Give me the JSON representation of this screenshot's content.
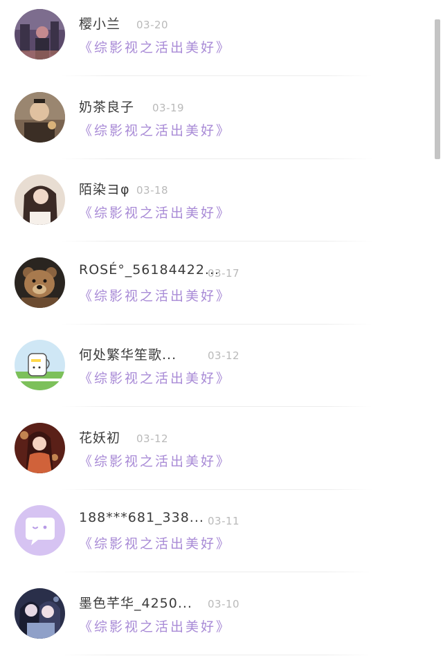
{
  "conversations": [
    {
      "name": "樱小兰",
      "date": "03-20",
      "book": "《综影视之活出美好》",
      "avatar_icon": "avatar-photo-icon",
      "avatar_colors": [
        "#5b4a6b",
        "#c48a8f",
        "#2f2a3a"
      ]
    },
    {
      "name": "奶茶良子",
      "date": "03-19",
      "book": "《综影视之活出美好》",
      "avatar_icon": "avatar-photo-icon",
      "avatar_colors": [
        "#7a6450",
        "#e0c1a0",
        "#3b2e25"
      ]
    },
    {
      "name": "陌染ヨφ",
      "date": "03-18",
      "book": "《综影视之活出美好》",
      "avatar_icon": "avatar-photo-icon",
      "avatar_colors": [
        "#d9cbbf",
        "#3b2a25",
        "#f0e6dc"
      ]
    },
    {
      "name": "ROSÉ°_56184422...",
      "date": "03-17",
      "book": "《综影视之活出美好》",
      "avatar_icon": "teddy-bear-icon",
      "avatar_colors": [
        "#2a2520",
        "#a87a4e",
        "#6b4b30"
      ]
    },
    {
      "name": "何处繁华笙歌...",
      "date": "03-12",
      "book": "《综影视之活出美好》",
      "avatar_icon": "cartoon-cup-icon",
      "avatar_colors": [
        "#cfe7f5",
        "#7cc05a",
        "#ffffff"
      ]
    },
    {
      "name": "花妖初",
      "date": "03-12",
      "book": "《综影视之活出美好》",
      "avatar_icon": "anime-girl-icon",
      "avatar_colors": [
        "#5a2018",
        "#d0623a",
        "#f0b06a"
      ]
    },
    {
      "name": "188***681_338...",
      "date": "03-11",
      "book": "《综影视之活出美好》",
      "avatar_icon": "chat-bubble-icon",
      "avatar_colors": [
        "#d6c3f2",
        "#ffffff",
        "#b79ae6"
      ]
    },
    {
      "name": "墨色芊华_4250...",
      "date": "03-10",
      "book": "《综影视之活出美好》",
      "avatar_icon": "anime-couple-icon",
      "avatar_colors": [
        "#2a2f4a",
        "#8fa0c8",
        "#e6d9e4"
      ]
    }
  ]
}
